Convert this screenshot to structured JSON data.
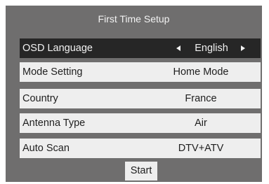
{
  "dialog": {
    "title": "First Time Setup",
    "rows": [
      {
        "label": "OSD Language",
        "value": "English",
        "selected": true
      },
      {
        "label": "Mode Setting",
        "value": "Home Mode",
        "selected": false
      },
      {
        "label": "Country",
        "value": "France",
        "selected": false
      },
      {
        "label": "Antenna Type",
        "value": "Air",
        "selected": false
      },
      {
        "label": "Auto Scan",
        "value": "DTV+ATV",
        "selected": false
      }
    ],
    "start_label": "Start"
  },
  "colors": {
    "panel_background": "#6f6e6e",
    "row_background": "#eeeeee",
    "selected_row_background": "#262626",
    "selected_text": "#f2f2f2",
    "row_text": "#1e1e1e"
  },
  "icons": {
    "previous": "left-arrow-icon",
    "next": "right-arrow-icon"
  }
}
